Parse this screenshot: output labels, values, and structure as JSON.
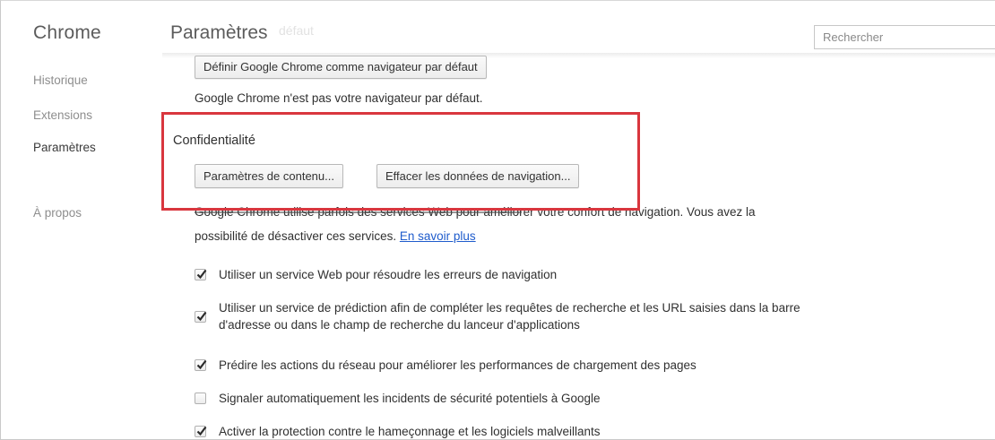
{
  "sidebar": {
    "app_title": "Chrome",
    "items": [
      {
        "label": "Historique",
        "selected": false
      },
      {
        "label": "Extensions",
        "selected": false
      },
      {
        "label": "Paramètres",
        "selected": true
      },
      {
        "label": "À propos",
        "selected": false
      }
    ]
  },
  "header": {
    "title": "Paramètres",
    "ghost_text": "défaut",
    "search_placeholder": "Rechercher"
  },
  "default_browser": {
    "button_label": "Définir Google Chrome comme navigateur par défaut",
    "status": "Google Chrome n'est pas votre navigateur par défaut."
  },
  "privacy": {
    "section_title": "Confidentialité",
    "content_settings_button": "Paramètres de contenu...",
    "clear_data_button": "Effacer les données de navigation...",
    "description_line1": "Google Chrome utilise parfois des services Web pour améliorer votre confort de navigation. Vous avez la",
    "description_line2": "possibilité de désactiver ces services. ",
    "learn_more": "En savoir plus",
    "options": [
      {
        "label": "Utiliser un service Web pour résoudre les erreurs de navigation",
        "checked": true
      },
      {
        "label_line1": "Utiliser un service de prédiction afin de compléter les requêtes de recherche et les URL saisies dans la barre",
        "label_line2": "d'adresse ou dans le champ de recherche du lanceur d'applications",
        "checked": true
      },
      {
        "label": "Prédire les actions du réseau pour améliorer les performances de chargement des pages",
        "checked": true
      },
      {
        "label": "Signaler automatiquement les incidents de sécurité potentiels à Google",
        "checked": false
      },
      {
        "label": "Activer la protection contre le hameçonnage et les logiciels malveillants",
        "checked": true
      }
    ]
  },
  "colors": {
    "highlight": "#d9363e",
    "link": "#1f5ccc"
  }
}
